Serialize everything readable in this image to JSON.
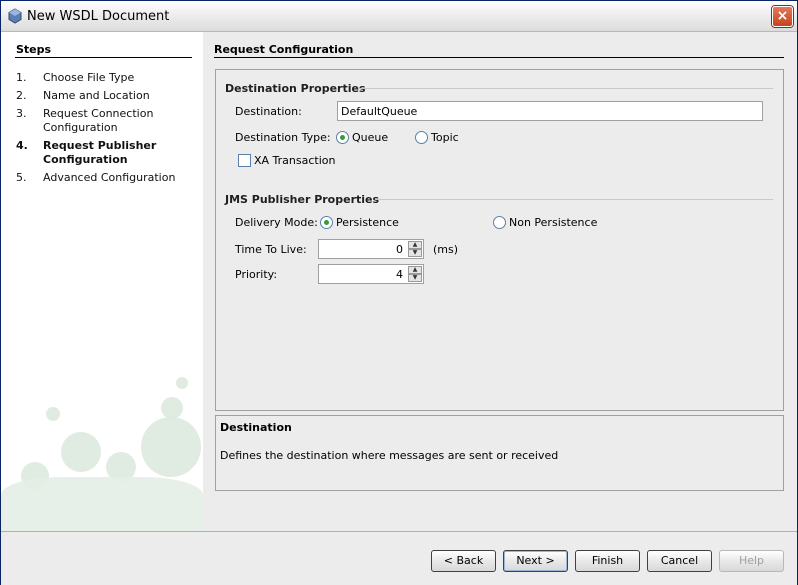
{
  "window": {
    "title": "New WSDL Document",
    "close_label": "×"
  },
  "steps": {
    "title": "Steps",
    "items": [
      {
        "num": "1.",
        "label": "Choose File Type"
      },
      {
        "num": "2.",
        "label": "Name and Location"
      },
      {
        "num": "3.",
        "label": "Request Connection Configuration"
      },
      {
        "num": "4.",
        "label": "Request Publisher Configuration",
        "current": true
      },
      {
        "num": "5.",
        "label": "Advanced Configuration"
      }
    ]
  },
  "panel": {
    "title": "Request Configuration",
    "destination_props": {
      "title": "Destination Properties",
      "destination_label": "Destination:",
      "destination_value": "DefaultQueue",
      "type_label": "Destination Type:",
      "queue_label": "Queue",
      "queue_selected": true,
      "topic_label": "Topic",
      "topic_selected": false,
      "xa_label": "XA Transaction",
      "xa_checked": false
    },
    "jms_props": {
      "title": "JMS Publisher Properties",
      "delivery_label": "Delivery Mode:",
      "persistence_label": "Persistence",
      "persistence_selected": true,
      "non_persistence_label": "Non Persistence",
      "non_persistence_selected": false,
      "ttl_label": "Time To Live:",
      "ttl_value": "0",
      "ttl_unit": "(ms)",
      "priority_label": "Priority:",
      "priority_value": "4"
    }
  },
  "description": {
    "title": "Destination",
    "text": "Defines the destination where messages are sent or received"
  },
  "buttons": {
    "back": "< Back",
    "next": "Next >",
    "finish": "Finish",
    "cancel": "Cancel",
    "help": "Help"
  }
}
